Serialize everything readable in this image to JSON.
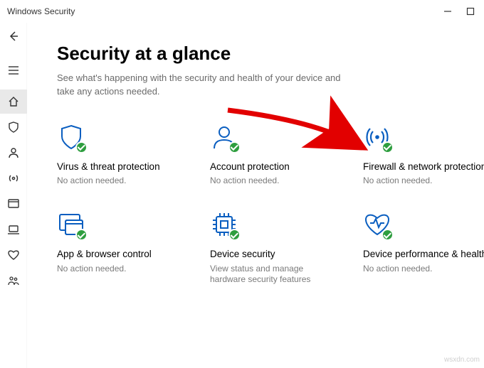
{
  "title": "Windows Security",
  "heading": "Security at a glance",
  "subtext": "See what's happening with the security and health of your device and take any actions needed.",
  "tiles": [
    {
      "title": "Virus & threat protection",
      "status": "No action needed."
    },
    {
      "title": "Account protection",
      "status": "No action needed."
    },
    {
      "title": "Firewall & network protection",
      "status": "No action needed."
    },
    {
      "title": "App & browser control",
      "status": "No action needed."
    },
    {
      "title": "Device security",
      "status": "View status and manage hardware security features"
    },
    {
      "title": "Device performance & health",
      "status": "No action needed."
    }
  ],
  "watermark": "wsxdn.com"
}
